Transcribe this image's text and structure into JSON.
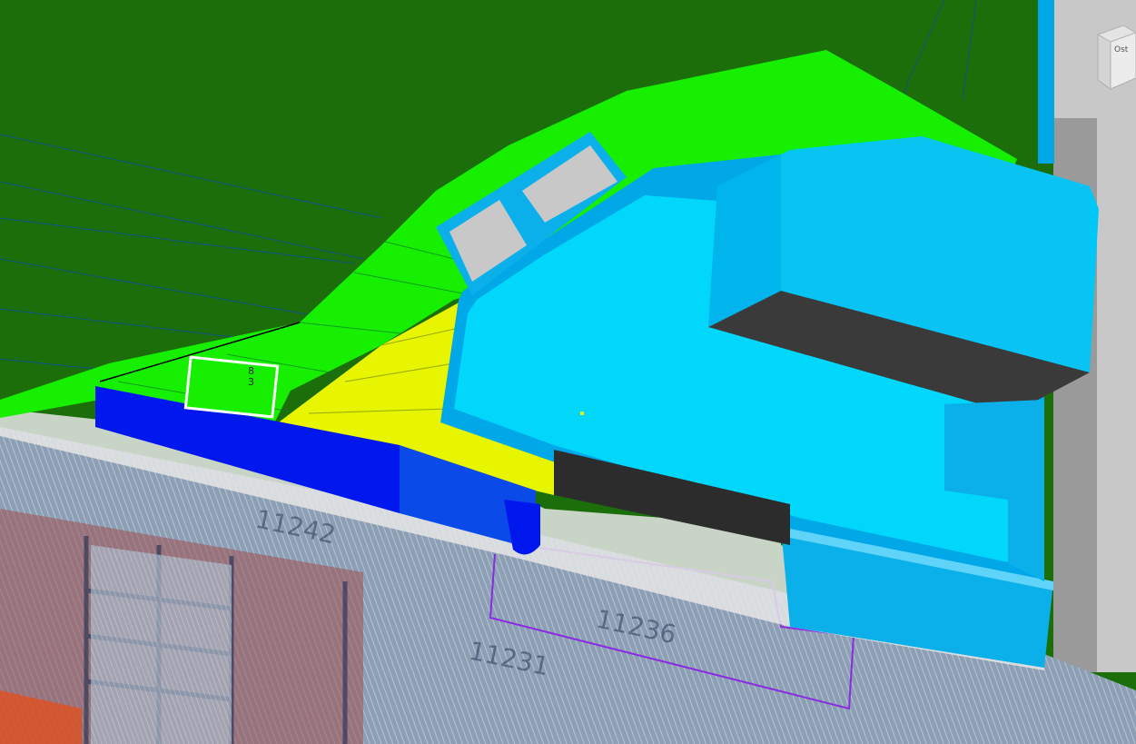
{
  "viewport": {
    "tag_top": "8",
    "tag_bottom": "3",
    "floor_labels": [
      "11242",
      "11236",
      "11231"
    ]
  },
  "viewcube": {
    "face_label": "Ost",
    "icon": "viewcube-icon"
  },
  "colors": {
    "dark_green": "#1b6e0a",
    "lime": "#16f000",
    "yellow": "#e8f500",
    "light_blue": "#00c8f6",
    "cyan": "#00d7fb",
    "blue": "#0018ee",
    "grey": "#c8c8c8",
    "charcoal": "#3a3a3a"
  }
}
